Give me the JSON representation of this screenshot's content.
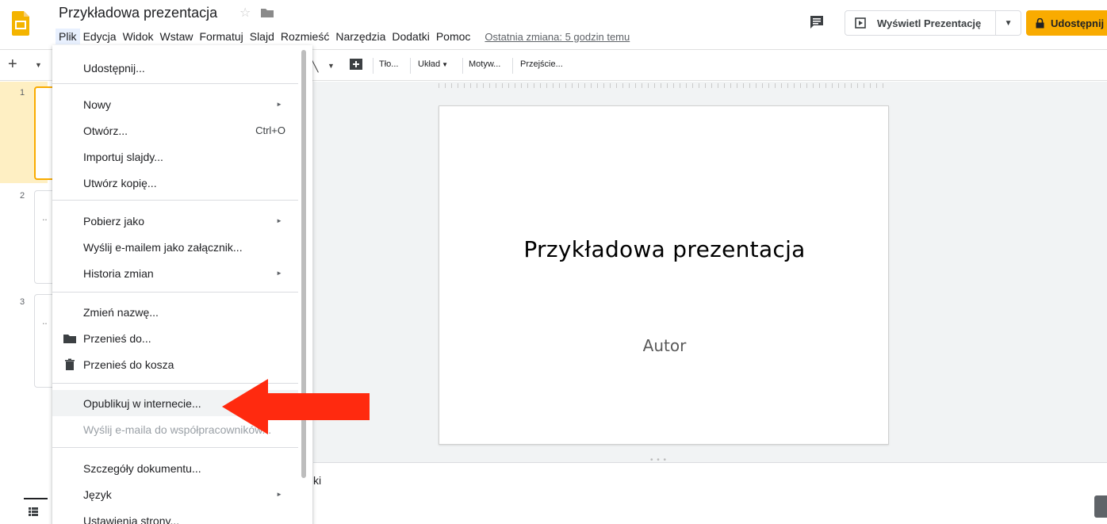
{
  "header": {
    "doc_title": "Przykładowa prezentacja",
    "menus": [
      "Plik",
      "Edycja",
      "Widok",
      "Wstaw",
      "Formatuj",
      "Slajd",
      "Rozmieść",
      "Narzędzia",
      "Dodatki",
      "Pomoc"
    ],
    "active_menu": "Plik",
    "last_edit": "Ostatnia zmiana: 5 godzin temu",
    "present_label": "Wyświetl Prezentację",
    "share_label": "Udostępnij",
    "accent_color": "#f9ab00"
  },
  "toolbar": {
    "new_slide": "+",
    "background": "Tło...",
    "layout": "Układ",
    "theme": "Motyw...",
    "transition": "Przejście..."
  },
  "filmstrip": {
    "slides": [
      {
        "number": "1"
      },
      {
        "number": "2"
      },
      {
        "number": "3"
      }
    ]
  },
  "slide": {
    "title": "Przykładowa prezentacja",
    "subtitle": "Autor"
  },
  "notes": {
    "partial_text": "ki"
  },
  "file_menu": {
    "items": [
      {
        "label": "Udostępnij..."
      },
      {
        "label": "Nowy",
        "submenu": "►"
      },
      {
        "label": "Otwórz...",
        "shortcut": "Ctrl+O"
      },
      {
        "label": "Importuj slajdy..."
      },
      {
        "label": "Utwórz kopię..."
      },
      {
        "label": "Pobierz jako",
        "submenu": "►"
      },
      {
        "label": "Wyślij e-mailem jako załącznik..."
      },
      {
        "label": "Historia zmian",
        "submenu": "►"
      },
      {
        "label": "Zmień nazwę..."
      },
      {
        "label": "Przenieś do...",
        "icon": "folder-icon"
      },
      {
        "label": "Przenieś do kosza",
        "icon": "trash-icon"
      },
      {
        "label": "Opublikuj w internecie..."
      },
      {
        "label": "Wyślij e-maila do współpracowników..."
      },
      {
        "label": "Szczegóły dokumentu..."
      },
      {
        "label": "Język",
        "submenu": "►"
      },
      {
        "label": "Ustawienia strony..."
      }
    ]
  },
  "annotation": {
    "arrow_color": "#ff2a0f"
  }
}
